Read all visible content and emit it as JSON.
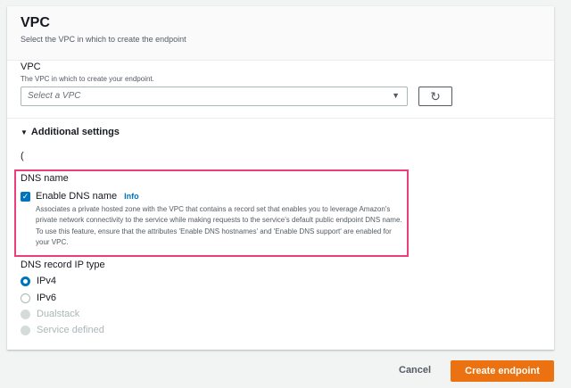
{
  "header": {
    "title": "VPC",
    "description": "Select the VPC in which to create the endpoint"
  },
  "vpc": {
    "label": "VPC",
    "description": "The VPC in which to create your endpoint.",
    "placeholder": "Select a VPC"
  },
  "additional_settings": {
    "label": "Additional settings",
    "stray_text": "("
  },
  "dns_name": {
    "label": "DNS name",
    "checkbox_label": "Enable DNS name",
    "checked": true,
    "info": "Info",
    "description": "Associates a private hosted zone with the VPC that contains a record set that enables you to leverage Amazon's private network connectivity to the service while making requests to the service's default public endpoint DNS name. To use this feature, ensure that the attributes 'Enable DNS hostnames' and 'Enable DNS support' are enabled for your VPC."
  },
  "dns_record_ip_type": {
    "label": "DNS record IP type",
    "options": [
      {
        "label": "IPv4",
        "selected": true,
        "disabled": false
      },
      {
        "label": "IPv6",
        "selected": false,
        "disabled": false
      },
      {
        "label": "Dualstack",
        "selected": false,
        "disabled": true
      },
      {
        "label": "Service defined",
        "selected": false,
        "disabled": true
      }
    ]
  },
  "actions": {
    "cancel": "Cancel",
    "create": "Create endpoint"
  },
  "colors": {
    "primary": "#ec7211",
    "link": "#0073bb",
    "highlight": "#ee3d7b"
  }
}
